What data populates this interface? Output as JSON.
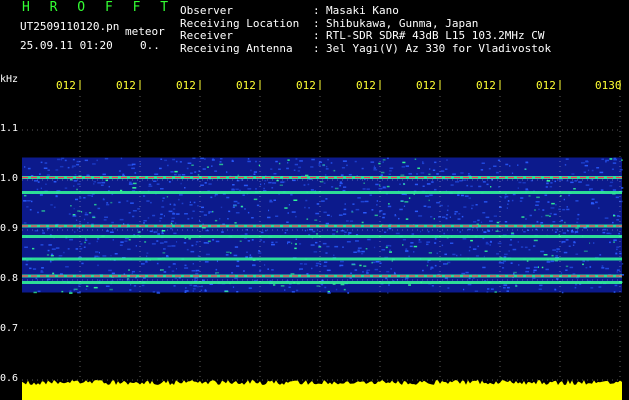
{
  "header": {
    "title": "H R O F F T",
    "filename": "UT2509110120.pn",
    "tag": "meteor",
    "datetime": "25.09.11 01:20",
    "status": "0.."
  },
  "metadata": [
    {
      "label": "Observer",
      "value": "Masaki Kano"
    },
    {
      "label": "Receiving Location",
      "value": "Shibukawa, Gunma, Japan"
    },
    {
      "label": "Receiver",
      "value": "RTL-SDR SDR# 43dB L15 103.2MHz CW"
    },
    {
      "label": "Receiving Antenna",
      "value": "3el Yagi(V) Az 330 for Vladivostok"
    }
  ],
  "separator": ":",
  "axis": {
    "unit": "kHz",
    "time_labels": [
      "012",
      "012",
      "012",
      "012",
      "012",
      "012",
      "012",
      "012",
      "012",
      "0130"
    ],
    "freq_labels": [
      "1.1",
      "1.0",
      "0.9",
      "0.8",
      "0.7",
      "0.6"
    ],
    "freq_values": [
      1.1,
      1.0,
      0.9,
      0.8,
      0.7,
      0.6
    ],
    "freq_range": [
      0.6,
      1.13
    ]
  },
  "spectrogram": {
    "band_lower_khz": 0.775,
    "band_upper_khz": 1.045,
    "lines_khz": [
      1.005,
      0.975,
      0.908,
      0.887,
      0.842,
      0.808,
      0.795
    ],
    "colors": {
      "background": "#000000",
      "band": "#0c1a8c",
      "noise": "#2a5cff",
      "line_green": "#33ff99",
      "line_red": "#ff3355",
      "grid": "#ffffff",
      "tick": "#ffff33",
      "amplitude": "#ffff00"
    }
  }
}
